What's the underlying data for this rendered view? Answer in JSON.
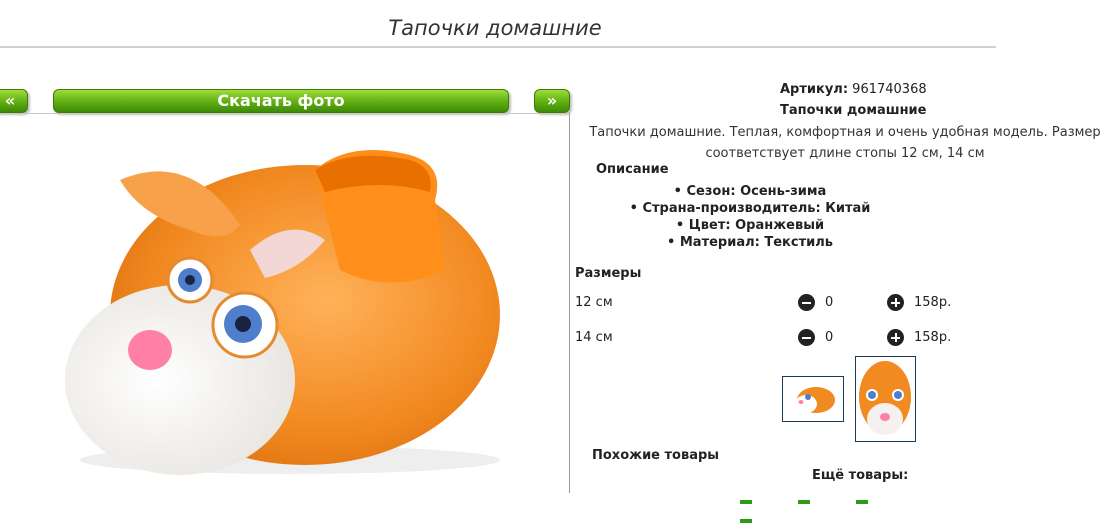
{
  "page": {
    "title": "Тапочки домашние"
  },
  "gallery": {
    "prev_label": "«",
    "download_label": "Скачать фото",
    "next_label": "»"
  },
  "product": {
    "article_label": "Артикул:",
    "article_value": "961740368",
    "name": "Тапочки домашние",
    "description": "Тапочки домашние. Теплая, комфортная и очень удобная модель. Размер соответствует длине стопы 12 см, 14 см",
    "description_heading": "Описание",
    "properties": [
      "Сезон: Осень-зима",
      "Страна-производитель: Китай",
      "Цвет: Оранжевый",
      "Материал: Текстиль"
    ]
  },
  "sizes": {
    "heading": "Размеры",
    "rows": [
      {
        "size": "12 см",
        "qty": "0",
        "price": "158р."
      },
      {
        "size": "14 см",
        "qty": "0",
        "price": "158р."
      }
    ]
  },
  "related": {
    "similar_heading": "Похожие товары",
    "more_heading": "Ещё товары:"
  },
  "colors": {
    "accent_green": "#5fae12",
    "fur_orange": "#f39a3a"
  }
}
